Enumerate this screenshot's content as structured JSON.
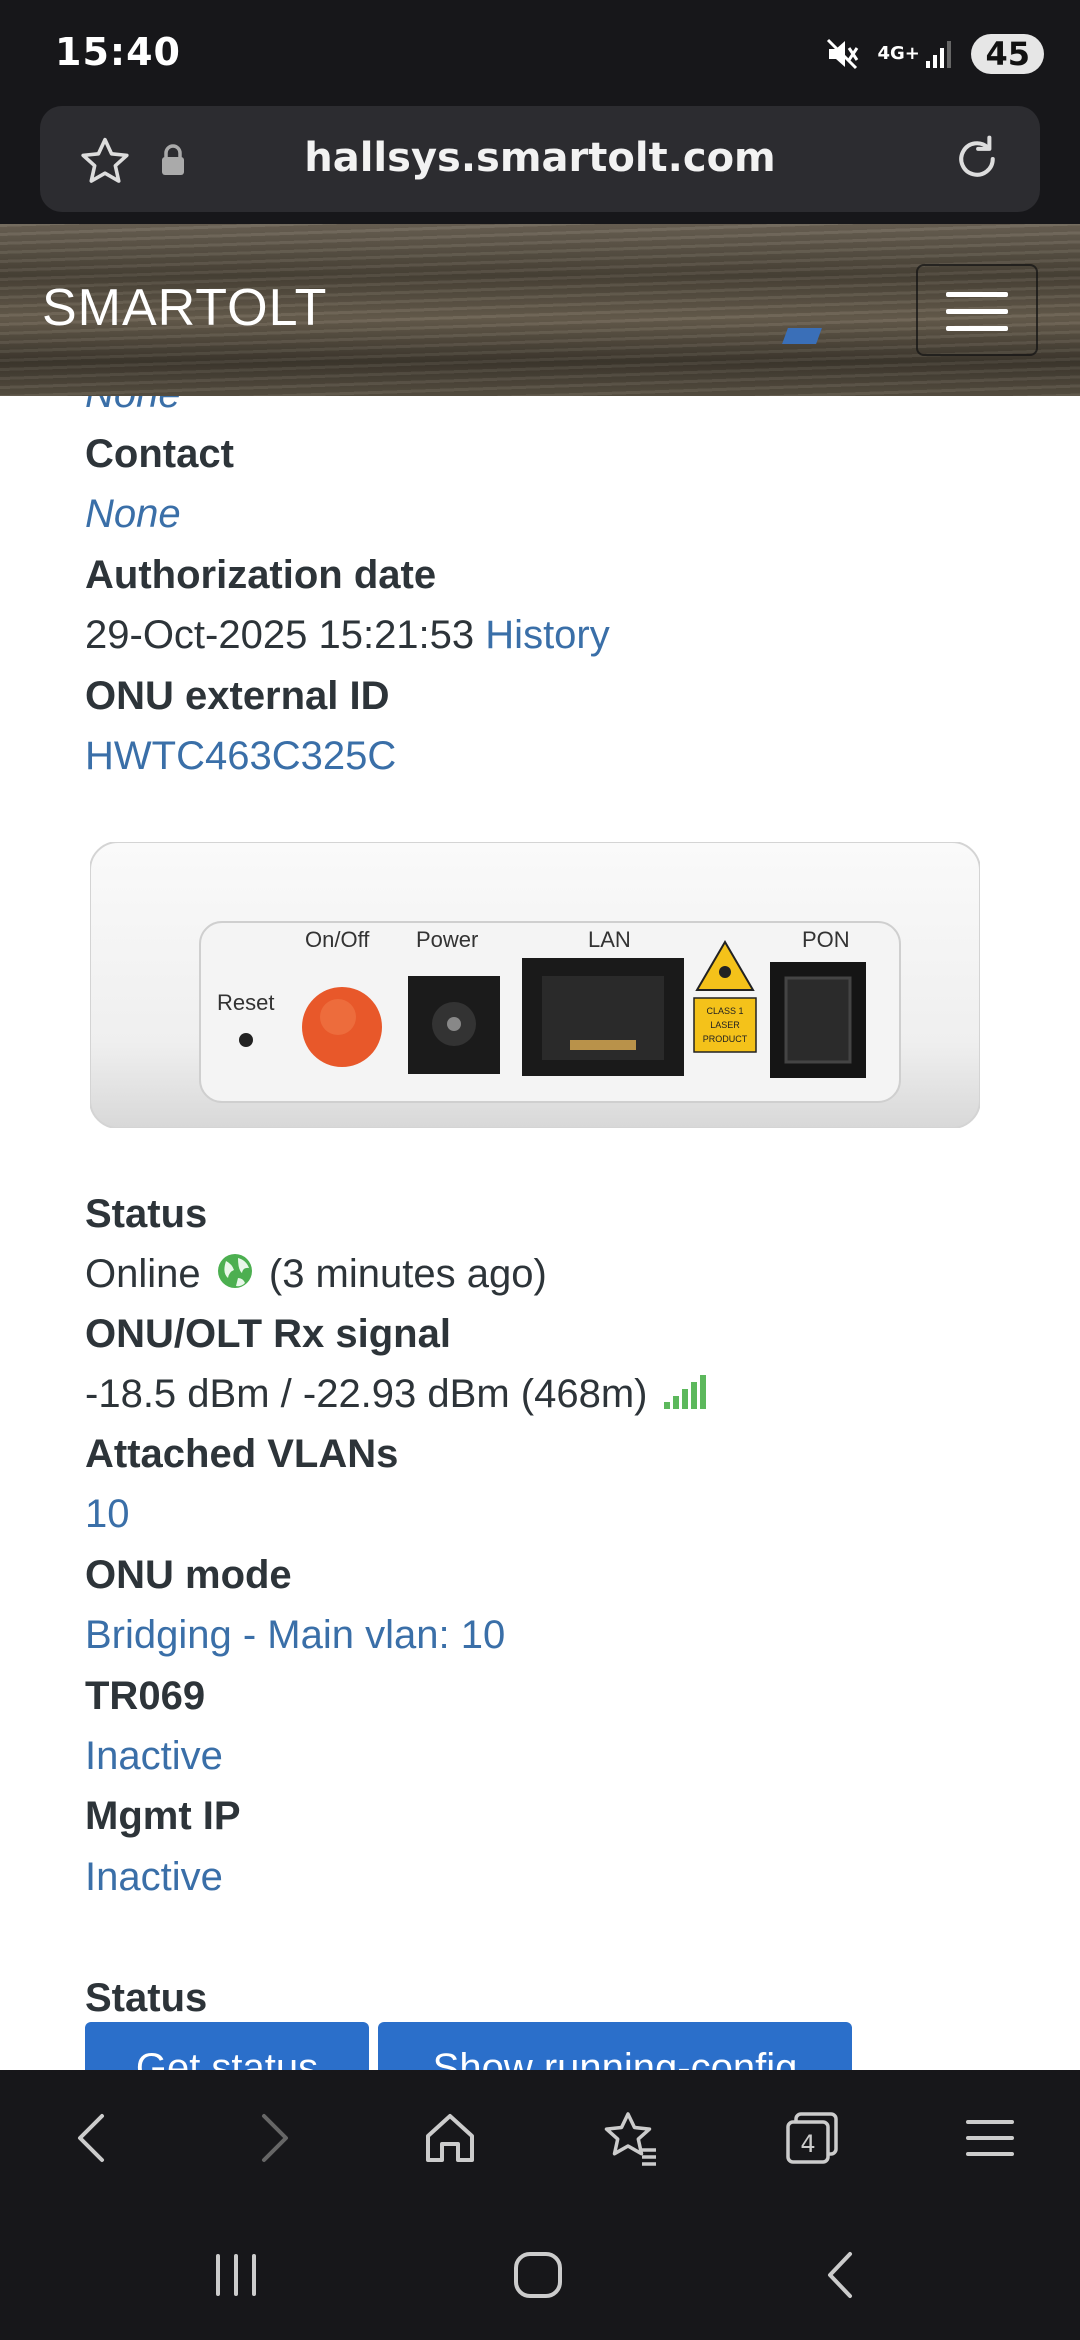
{
  "statusbar": {
    "time": "15:40",
    "network": "4G+",
    "battery": "45",
    "icons": [
      "mute-icon",
      "signal-icon"
    ]
  },
  "browser": {
    "url": "hallsys.smartolt.com",
    "icons": [
      "star-icon",
      "lock-icon",
      "reload-icon"
    ]
  },
  "site": {
    "brand": "SMARTOLT"
  },
  "details": {
    "prev_value": "None",
    "contact_label": "Contact",
    "contact_value": "None",
    "auth_label": "Authorization date",
    "auth_value": "29-Oct-2025 15:21:53",
    "auth_history": "History",
    "ext_id_label": "ONU external ID",
    "ext_id_value": "HWTC463C325C"
  },
  "device_image": {
    "reset": "Reset",
    "onoff": "On/Off",
    "power": "Power",
    "lan": "LAN",
    "pon": "PON",
    "laser_line1": "CLASS 1",
    "laser_line2": "LASER",
    "laser_line3": "PRODUCT"
  },
  "status": {
    "status_label": "Status",
    "status_value": "Online",
    "status_time": "(3 minutes ago)",
    "rx_label": "ONU/OLT Rx signal",
    "rx_value": "-18.5 dBm / -22.93 dBm (468m)",
    "vlans_label": "Attached VLANs",
    "vlans_value": "10",
    "mode_label": "ONU mode",
    "mode_value": "Bridging - Main vlan: 10",
    "tr069_label": "TR069",
    "tr069_value": "Inactive",
    "mgmt_label": "Mgmt IP",
    "mgmt_value": "Inactive",
    "section_label": "Status",
    "get_status": "Get status",
    "show_config": "Show running-config"
  },
  "bottomnav": {
    "icons": [
      "back-icon",
      "forward-icon",
      "home-icon",
      "bookmarks-icon",
      "tabs-icon",
      "menu-icon"
    ],
    "tab_count": "4"
  },
  "colors": {
    "link": "#3a6fa8",
    "text": "#2d3439",
    "button": "#2b6fca",
    "online_green": "#4caf50",
    "chrome_bg": "#17171a"
  }
}
